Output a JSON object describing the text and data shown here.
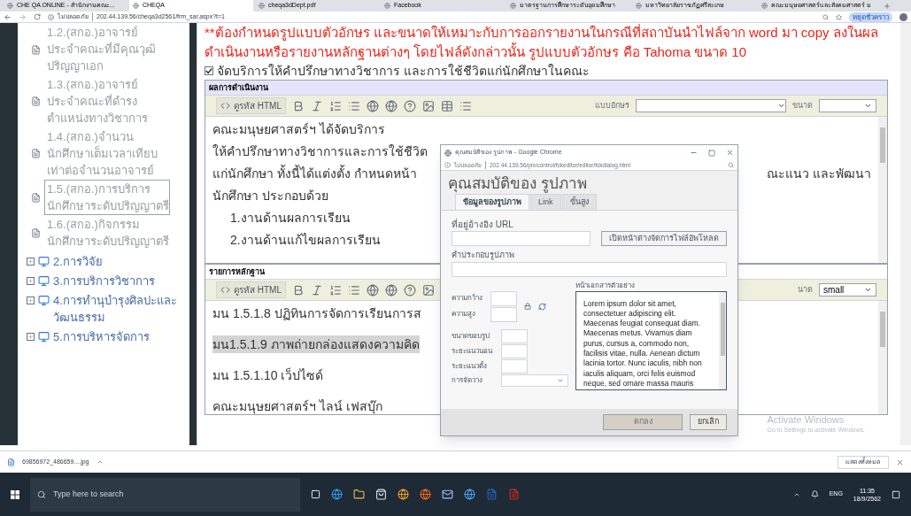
{
  "browser": {
    "tabs": [
      {
        "title": "CHE QA ONLINE - สำนักงานคณะ...",
        "selected": false
      },
      {
        "title": "CHEQA",
        "selected": true
      },
      {
        "title": "cheqa3dDept.pdf",
        "selected": false
      },
      {
        "title": "Facebook",
        "selected": false
      },
      {
        "title": "มาตรฐานการศึกษาระดับอุดมศึกษา",
        "selected": false
      },
      {
        "title": "มหาวิทยาลัยราชภัฏศรีสะเกษ",
        "selected": false
      },
      {
        "title": "คณะมนุษยศาสตร์และสังคมศาสตร์ ม",
        "selected": false
      }
    ],
    "security": "ไม่ปลอดภัย",
    "url": "202.44.139.56/cheqa3d2561/frm_sar.aspx?t=1",
    "profile": "หยุดชั่วคราว"
  },
  "sidebar": {
    "items": [
      {
        "lines": [
          "1.2.(สกอ.)อาจารย์",
          "ประจำคณะที่มีคุณวุฒิ",
          "ปริญญาเอก"
        ],
        "selected": false
      },
      {
        "lines": [
          "1.3.(สกอ.)อาจารย์",
          "ประจำคณะที่ดำรง",
          "ตำแหน่งทางวิชาการ"
        ],
        "selected": false
      },
      {
        "lines": [
          "1.4.(สกอ.)จำนวน",
          "นักศึกษาเต็มเวลาเทียบ",
          "เท่าต่อจำนวนอาจารย์"
        ],
        "selected": false
      },
      {
        "lines": [
          "1.5.(สกอ.)การบริการ",
          "นักศึกษาระดับปริญญาตรี"
        ],
        "selected": true
      },
      {
        "lines": [
          "1.6.(สกอ.)กิจกรรม",
          "นักศึกษาระดับปริญญาตรี"
        ],
        "selected": false
      }
    ],
    "sections": [
      {
        "label": "2.การวิจัย",
        "expanded": false
      },
      {
        "label": "3.การบริการวิชาการ",
        "expanded": false
      },
      {
        "label": "4.การทำนุบำรุงศิลปะและวัฒนธรรม",
        "expanded": false
      },
      {
        "label": "5.การบริหารจัดการ",
        "expanded": false
      }
    ]
  },
  "notice": [
    "**ต้องกำหนดรูปแบบตัวอักษร และขนาดให้เหมาะกับการออกรายงานในกรณีที่สถาบันนำไฟล์จาก word มา copy ลงในผล",
    "ดำเนินงานหรือรายงานหลักฐานต่างๆ โดยไฟล์ดังกล่าวนั้น รูปแบบตัวอักษร คือ Tahoma ขนาด 10"
  ],
  "topic": {
    "label": "จัดบริการให้คำปรึกษาทางวิชาการ และการใช้ชีวิตแก่นักศึกษาในคณะ",
    "checked": true
  },
  "editors": [
    {
      "header": "ผลการดำเนินงาน",
      "html_button": "ดูรหัส HTML",
      "font_label": "แบบอักษร",
      "size_label": "ขนาด",
      "lines": [
        {
          "left": "คณะมนุษยศาสตร์ฯ ได้จัดบริการ",
          "highlighted": false
        },
        {
          "left": "ให้คำปรึกษาทางวิชาการและการใช้ชีวิต",
          "highlighted": false
        },
        {
          "left": "แก่นักศึกษา ทั้งนี้ได้แต่งตั้ง กำหนดหน้า",
          "right": "ณะแนว  และพัฒนา",
          "highlighted": false
        },
        {
          "left": "นักศึกษา  ประกอบด้วย",
          "highlighted": false,
          "children": [
            {
              "left": "1.งานด้านผลการเรียน",
              "highlighted": false
            },
            {
              "left": "2.งานด้านแก้ไขผลการเรียน",
              "highlighted": false
            }
          ]
        }
      ]
    },
    {
      "header": "รายการหลักฐาน",
      "html_button": "ดูรหัส HTML",
      "size_label": "นาด",
      "size_value": "small",
      "lines": [
        {
          "left": "มน 1.5.1.8 ปฏิทินการจัดการเรียนการส",
          "highlighted": false
        },
        {
          "left": "มน1.5.1.9 ภาพถ่ายกล่องแสดงความคิด",
          "highlighted": true
        },
        {
          "left": "มน 1.5.1.10 เว็ปไซด์",
          "highlighted": false
        },
        {
          "left": "คณะมนุษยศาสตร์ฯ ไลน์ เฟสบุ๊ก",
          "highlighted": false
        }
      ]
    }
  ],
  "dialog": {
    "window_title": "คุณสมบัติของ รูปภาพ - Google Chrome",
    "security": "ไม่ปลอดภัย",
    "url": "202.44.139.56/pix/control/fckeditor/editor/fckdialog.html",
    "title": "คุณสมบัติของ รูปภาพ",
    "tabs": [
      {
        "label": "ข้อมูลของรูปภาพ",
        "selected": true
      },
      {
        "label": "Link",
        "selected": false
      },
      {
        "label": "ขั้นสูง",
        "selected": false
      }
    ],
    "url_label": "ที่อยู่อ้างอิง URL",
    "browse_button": "เปิดหน้าต่างจัดการไฟล์อัพโหลด",
    "alt_label": "คำประกอบรูปภาพ",
    "size_fields": [
      "ความกว้าง",
      "ความสูง"
    ],
    "spacing_fields": [
      "ขนาดขอบรูป",
      "ระยะแนวนอน",
      "ระยะแนวตั้ง"
    ],
    "align_label": "การจัดวาง",
    "preview_label": "หน้าเอกสารตัวอย่าง",
    "preview_text": "Lorem ipsum dolor sit amet, consectetuer adipiscing elit. Maecenas feugiat consequat diam. Maecenas metus. Vivamus diam purus, cursus a, commodo non, facilisis vitae, nulla. Aenean dictum lacinia tortor. Nunc iaculis, nibh non iaculis aliquam, orci felis euismod neque, sed ornare massa mauris",
    "ok": {
      "label": "ตกลง",
      "disabled": true
    },
    "cancel": {
      "label": "ยกเลิก",
      "disabled": false
    }
  },
  "activation": [
    "Activate Windows",
    "Go to Settings to activate Windows."
  ],
  "downloads": {
    "file": "69856972_486659....jpg",
    "show_all": "แสดงทั้งหมด"
  },
  "taskbar": {
    "search_placeholder": "Type here to search",
    "language": "ENG",
    "time": "11:35",
    "date": "18/9/2562"
  }
}
